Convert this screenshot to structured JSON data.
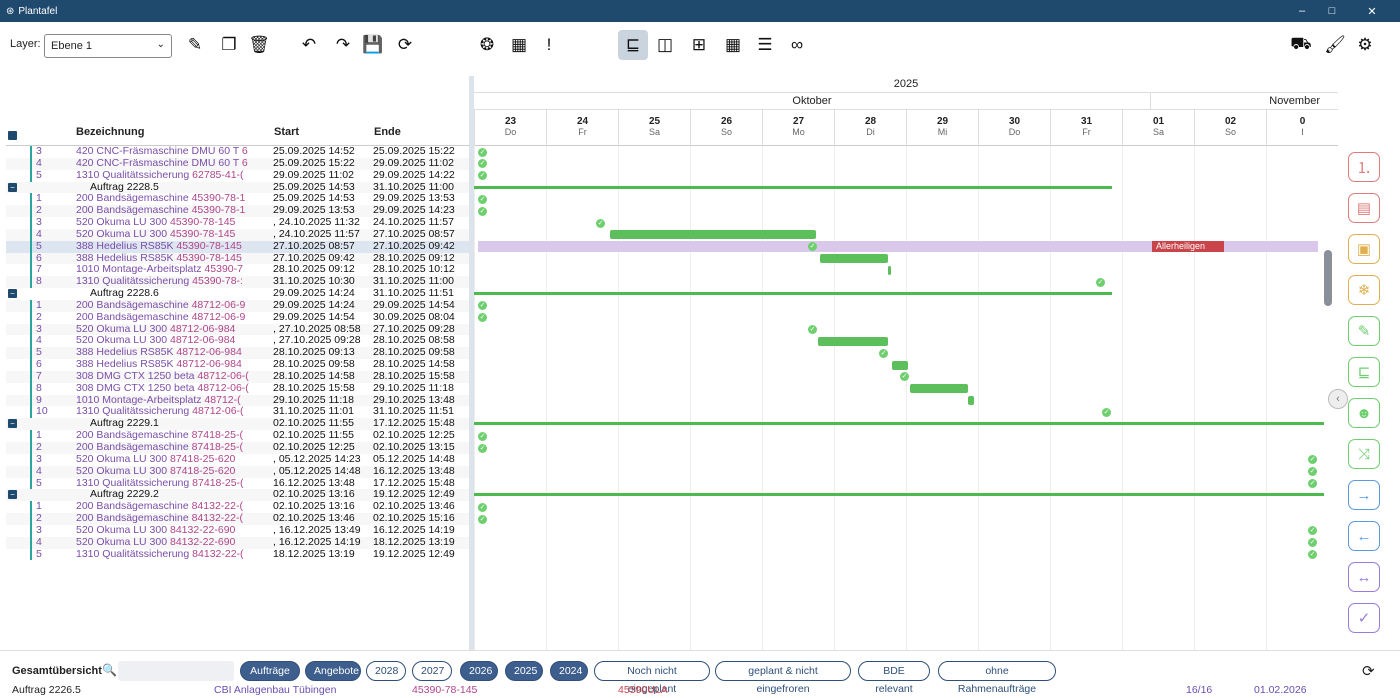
{
  "window": {
    "title": "Plantafel",
    "minimize": "–",
    "maximize": "□",
    "close": "✕"
  },
  "toolbar": {
    "layer_label": "Layer:",
    "layer_value": "Ebene 1"
  },
  "header": {
    "year": "2025",
    "month1": "Oktober",
    "month2": "November",
    "col_bezeichnung": "Bezeichnung",
    "col_start": "Start",
    "col_ende": "Ende"
  },
  "days": [
    {
      "n": "23",
      "w": "Do"
    },
    {
      "n": "24",
      "w": "Fr"
    },
    {
      "n": "25",
      "w": "Sa"
    },
    {
      "n": "26",
      "w": "So"
    },
    {
      "n": "27",
      "w": "Mo"
    },
    {
      "n": "28",
      "w": "Di"
    },
    {
      "n": "29",
      "w": "Mi"
    },
    {
      "n": "30",
      "w": "Do"
    },
    {
      "n": "31",
      "w": "Fr"
    },
    {
      "n": "01",
      "w": "Sa"
    },
    {
      "n": "02",
      "w": "So"
    },
    {
      "n": "0",
      "w": "I"
    }
  ],
  "holiday": "Allerheiligen",
  "rows": [
    {
      "num": "3",
      "name": "420 CNC-Fräsmaschine DMU 60 T",
      "code": "6",
      "start": "25.09.2025 14:52",
      "ende": "25.09.2025 15:22"
    },
    {
      "num": "4",
      "name": "420 CNC-Fräsmaschine DMU 60 T",
      "code": "6",
      "start": "25.09.2025 15:22",
      "ende": "29.09.2025 11:02"
    },
    {
      "num": "5",
      "name": "1310 Qualitätssicherung",
      "code": "62785-41-(",
      "start": "29.09.2025 11:02",
      "ende": "29.09.2025 14:22"
    },
    {
      "auftrag": "Auftrag 2228.5",
      "start": "25.09.2025 14:53",
      "ende": "31.10.2025 11:00"
    },
    {
      "num": "1",
      "name": "200 Bandsägemaschine",
      "code": "45390-78-1",
      "start": "25.09.2025 14:53",
      "ende": "29.09.2025 13:53"
    },
    {
      "num": "2",
      "name": "200 Bandsägemaschine",
      "code": "45390-78-1",
      "start": "29.09.2025 13:53",
      "ende": "29.09.2025 14:23"
    },
    {
      "num": "3",
      "name": "520 Okuma LU 300",
      "code": "45390-78-145",
      "start": ", 24.10.2025 11:32",
      "ende": "24.10.2025 11:57"
    },
    {
      "num": "4",
      "name": "520 Okuma LU 300",
      "code": "45390-78-145",
      "start": ", 24.10.2025 11:57",
      "ende": "27.10.2025 08:57"
    },
    {
      "num": "5",
      "name": "388 Hedelius RS85K",
      "code": "45390-78-145",
      "start": "27.10.2025 08:57",
      "ende": "27.10.2025 09:42"
    },
    {
      "num": "6",
      "name": "388 Hedelius RS85K",
      "code": "45390-78-145",
      "start": "27.10.2025 09:42",
      "ende": "28.10.2025 09:12"
    },
    {
      "num": "7",
      "name": "1010 Montage-Arbeitsplatz",
      "code": "45390-7",
      "start": "28.10.2025 09:12",
      "ende": "28.10.2025 10:12"
    },
    {
      "num": "8",
      "name": "1310 Qualitätssicherung",
      "code": "45390-78-:",
      "start": "31.10.2025 10:30",
      "ende": "31.10.2025 11:00"
    },
    {
      "auftrag": "Auftrag 2228.6",
      "start": "29.09.2025 14:24",
      "ende": "31.10.2025 11:51"
    },
    {
      "num": "1",
      "name": "200 Bandsägemaschine",
      "code": "48712-06-9",
      "start": "29.09.2025 14:24",
      "ende": "29.09.2025 14:54"
    },
    {
      "num": "2",
      "name": "200 Bandsägemaschine",
      "code": "48712-06-9",
      "start": "29.09.2025 14:54",
      "ende": "30.09.2025 08:04"
    },
    {
      "num": "3",
      "name": "520 Okuma LU 300",
      "code": "48712-06-984",
      "start": ", 27.10.2025 08:58",
      "ende": "27.10.2025 09:28"
    },
    {
      "num": "4",
      "name": "520 Okuma LU 300",
      "code": "48712-06-984",
      "start": ", 27.10.2025 09:28",
      "ende": "28.10.2025 08:58"
    },
    {
      "num": "5",
      "name": "388 Hedelius RS85K",
      "code": "48712-06-984",
      "start": "28.10.2025 09:13",
      "ende": "28.10.2025 09:58"
    },
    {
      "num": "6",
      "name": "388 Hedelius RS85K",
      "code": "48712-06-984",
      "start": "28.10.2025 09:58",
      "ende": "28.10.2025 14:58"
    },
    {
      "num": "7",
      "name": "308 DMG CTX 1250 beta",
      "code": "48712-06-(",
      "start": "28.10.2025 14:58",
      "ende": "28.10.2025 15:58"
    },
    {
      "num": "8",
      "name": "308 DMG CTX 1250 beta",
      "code": "48712-06-(",
      "start": "28.10.2025 15:58",
      "ende": "29.10.2025 11:18"
    },
    {
      "num": "9",
      "name": "1010 Montage-Arbeitsplatz",
      "code": "48712-(",
      "start": "29.10.2025 11:18",
      "ende": "29.10.2025 13:48"
    },
    {
      "num": "10",
      "name": "1310 Qualitätssicherung",
      "code": "48712-06-(",
      "start": "31.10.2025 11:01",
      "ende": "31.10.2025 11:51"
    },
    {
      "auftrag": "Auftrag 2229.1",
      "start": "02.10.2025 11:55",
      "ende": "17.12.2025 15:48"
    },
    {
      "num": "1",
      "name": "200 Bandsägemaschine",
      "code": "87418-25-(",
      "start": "02.10.2025 11:55",
      "ende": "02.10.2025 12:25"
    },
    {
      "num": "2",
      "name": "200 Bandsägemaschine",
      "code": "87418-25-(",
      "start": "02.10.2025 12:25",
      "ende": "02.10.2025 13:15"
    },
    {
      "num": "3",
      "name": "520 Okuma LU 300",
      "code": "87418-25-620",
      "start": ", 05.12.2025 14:23",
      "ende": "05.12.2025 14:48"
    },
    {
      "num": "4",
      "name": "520 Okuma LU 300",
      "code": "87418-25-620",
      "start": ", 05.12.2025 14:48",
      "ende": "16.12.2025 13:48"
    },
    {
      "num": "5",
      "name": "1310 Qualitätssicherung",
      "code": "87418-25-(",
      "start": "16.12.2025 13:48",
      "ende": "17.12.2025 15:48"
    },
    {
      "auftrag": "Auftrag 2229.2",
      "start": "02.10.2025 13:16",
      "ende": "19.12.2025 12:49"
    },
    {
      "num": "1",
      "name": "200 Bandsägemaschine",
      "code": "84132-22-(",
      "start": "02.10.2025 13:16",
      "ende": "02.10.2025 13:46"
    },
    {
      "num": "2",
      "name": "200 Bandsägemaschine",
      "code": "84132-22-(",
      "start": "02.10.2025 13:46",
      "ende": "02.10.2025 15:16"
    },
    {
      "num": "3",
      "name": "520 Okuma LU 300",
      "code": "84132-22-690",
      "start": ", 16.12.2025 13:49",
      "ende": "16.12.2025 14:19"
    },
    {
      "num": "4",
      "name": "520 Okuma LU 300",
      "code": "84132-22-690",
      "start": ", 16.12.2025 14:19",
      "ende": "18.12.2025 13:19"
    },
    {
      "num": "5",
      "name": "1310 Qualitätssicherung",
      "code": "84132-22-(",
      "start": "18.12.2025 13:19",
      "ende": "19.12.2025 12:49"
    }
  ],
  "bottom": {
    "label": "Gesamtübersicht",
    "chips": [
      "Aufträge",
      "Angebote",
      "2028",
      "2027",
      "2026",
      "2025",
      "2024",
      "Noch nicht eingeplant",
      "geplant & nicht eingefroren",
      "BDE relevant",
      "ohne Rahmenaufträge"
    ],
    "status_auftrag": "Auftrag 2226.5",
    "status_customer": "CBI Anlagenbau Tübingen",
    "status_code": "45390-78-145",
    "status_order": "45390ULA",
    "status_count": "16/16",
    "status_date": "01.02.2026"
  }
}
